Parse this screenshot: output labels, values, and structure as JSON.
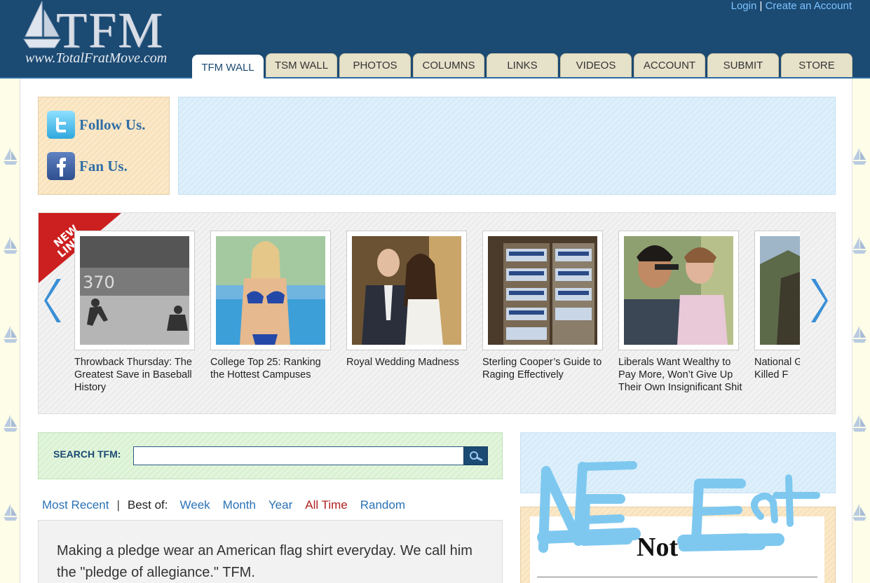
{
  "header": {
    "logo_text": "TFM",
    "logo_url": "www.TotalFratMove.com",
    "login_label": "Login",
    "separator": "|",
    "create_account_label": "Create an Account"
  },
  "tabs": [
    {
      "label": "TFM WALL",
      "active": true
    },
    {
      "label": "TSM WALL"
    },
    {
      "label": "PHOTOS"
    },
    {
      "label": "COLUMNS"
    },
    {
      "label": "LINKS"
    },
    {
      "label": "VIDEOS"
    },
    {
      "label": "ACCOUNT"
    },
    {
      "label": "SUBMIT"
    },
    {
      "label": "STORE"
    }
  ],
  "social": {
    "twitter_label": "Follow Us.",
    "facebook_label": "Fan Us."
  },
  "carousel": {
    "ribbon_line1": "NEW",
    "ribbon_line2": "LINKS",
    "items": [
      {
        "caption": "Throwback Thursday: The Greatest Save in Baseball History"
      },
      {
        "caption": "College Top 25: Ranking the Hottest Campuses"
      },
      {
        "caption": "Royal Wedding Madness"
      },
      {
        "caption": "Sterling Cooper’s Guide to Raging Effectively"
      },
      {
        "caption": "Liberals Want Wealthy to Pay More, Won’t Give Up Their Own Insignificant Shit"
      },
      {
        "caption": "National G Re-Air Re of Killed F"
      }
    ],
    "thumb1_text": "370"
  },
  "search": {
    "label": "SEARCH TFM:",
    "value": "",
    "placeholder": ""
  },
  "filters": {
    "most_recent": "Most Recent",
    "separator": "|",
    "best_of": "Best of:",
    "week": "Week",
    "month": "Month",
    "year": "Year",
    "all_time": "All Time",
    "random": "Random"
  },
  "post": {
    "text": "Making a pledge wear an American flag shirt everyday. We call him the \"pledge of allegiance.\" TFM."
  },
  "nfe": {
    "title": "Not"
  },
  "colors": {
    "header_bg": "#1b4a73",
    "link_blue": "#2a72b5",
    "active_red": "#b02020",
    "ribbon_red": "#cc1f1f",
    "scribble": "#7ec8f0"
  }
}
